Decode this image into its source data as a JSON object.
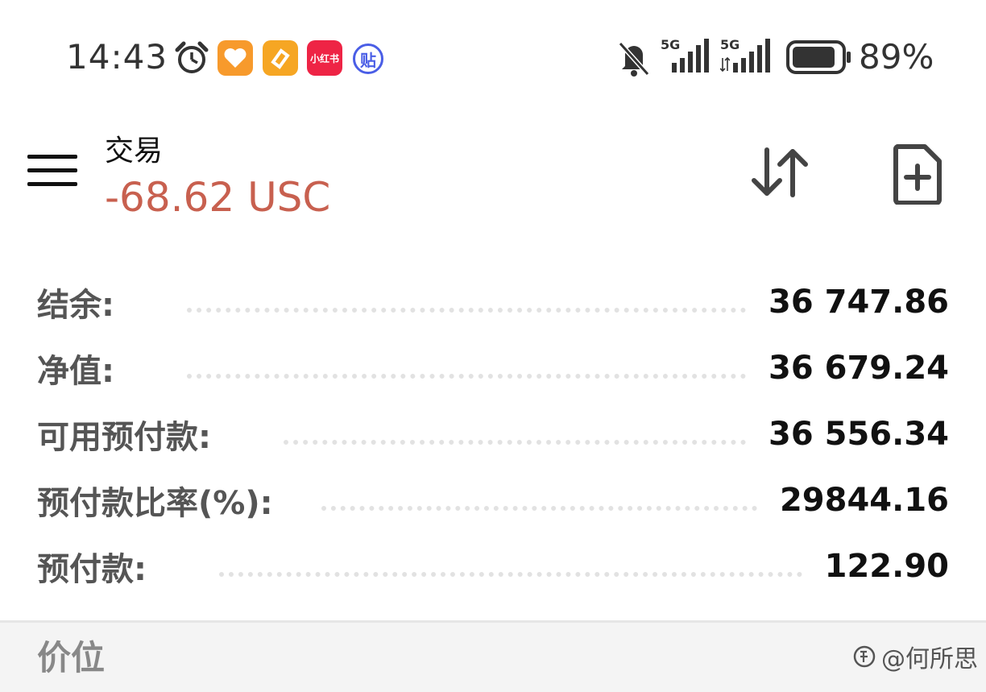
{
  "status_bar": {
    "time": "14:43",
    "notif_icons": [
      "alarm-icon",
      "heart-app-icon",
      "health-app-icon",
      "xiaohongshu-app-icon",
      "tieba-app-icon"
    ],
    "xiaohongshu_text": "小红书",
    "tieba_text": "贴",
    "network_1": "5G",
    "network_2": "5G",
    "battery_percent": "89%",
    "battery_level": 0.89
  },
  "header": {
    "title": "交易",
    "balance_change": "-68.62 USC",
    "balance_change_color": "#c8604f"
  },
  "account": {
    "rows": [
      {
        "label": "结余:",
        "value": "36 747.86"
      },
      {
        "label": "净值:",
        "value": "36 679.24"
      },
      {
        "label": "可用预付款:",
        "value": "36 556.34"
      },
      {
        "label": "预付款比率(%):",
        "value": "29844.16"
      },
      {
        "label": "预付款:",
        "value": "122.90"
      }
    ]
  },
  "price_section": {
    "label": "价位",
    "watermark": "@何所思"
  }
}
